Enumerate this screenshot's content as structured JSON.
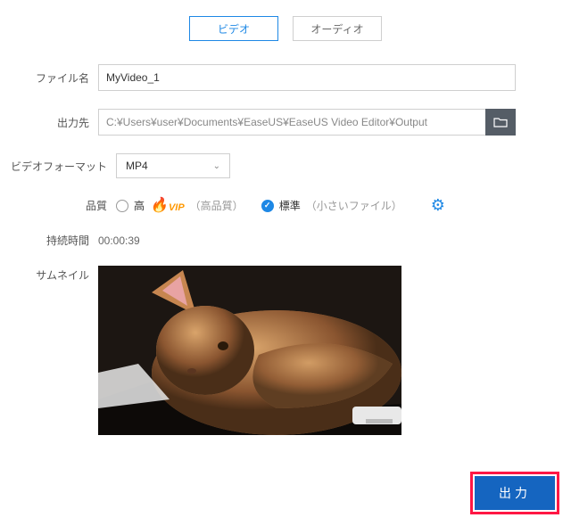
{
  "tabs": {
    "video": "ビデオ",
    "audio": "オーディオ"
  },
  "labels": {
    "filename": "ファイル名",
    "output_dir": "出力先",
    "video_format": "ビデオフォーマット",
    "quality": "品質",
    "duration": "持続時間",
    "thumbnail": "サムネイル"
  },
  "values": {
    "filename": "MyVideo_1",
    "output_dir": "C:¥Users¥user¥Documents¥EaseUS¥EaseUS Video Editor¥Output",
    "format": "MP4",
    "duration": "00:00:39"
  },
  "quality": {
    "high_label": "高",
    "vip_label": "VIP",
    "high_suffix": "（高品質）",
    "standard_label": "標準",
    "standard_suffix": "（小さいファイル）"
  },
  "buttons": {
    "export": "出力"
  }
}
